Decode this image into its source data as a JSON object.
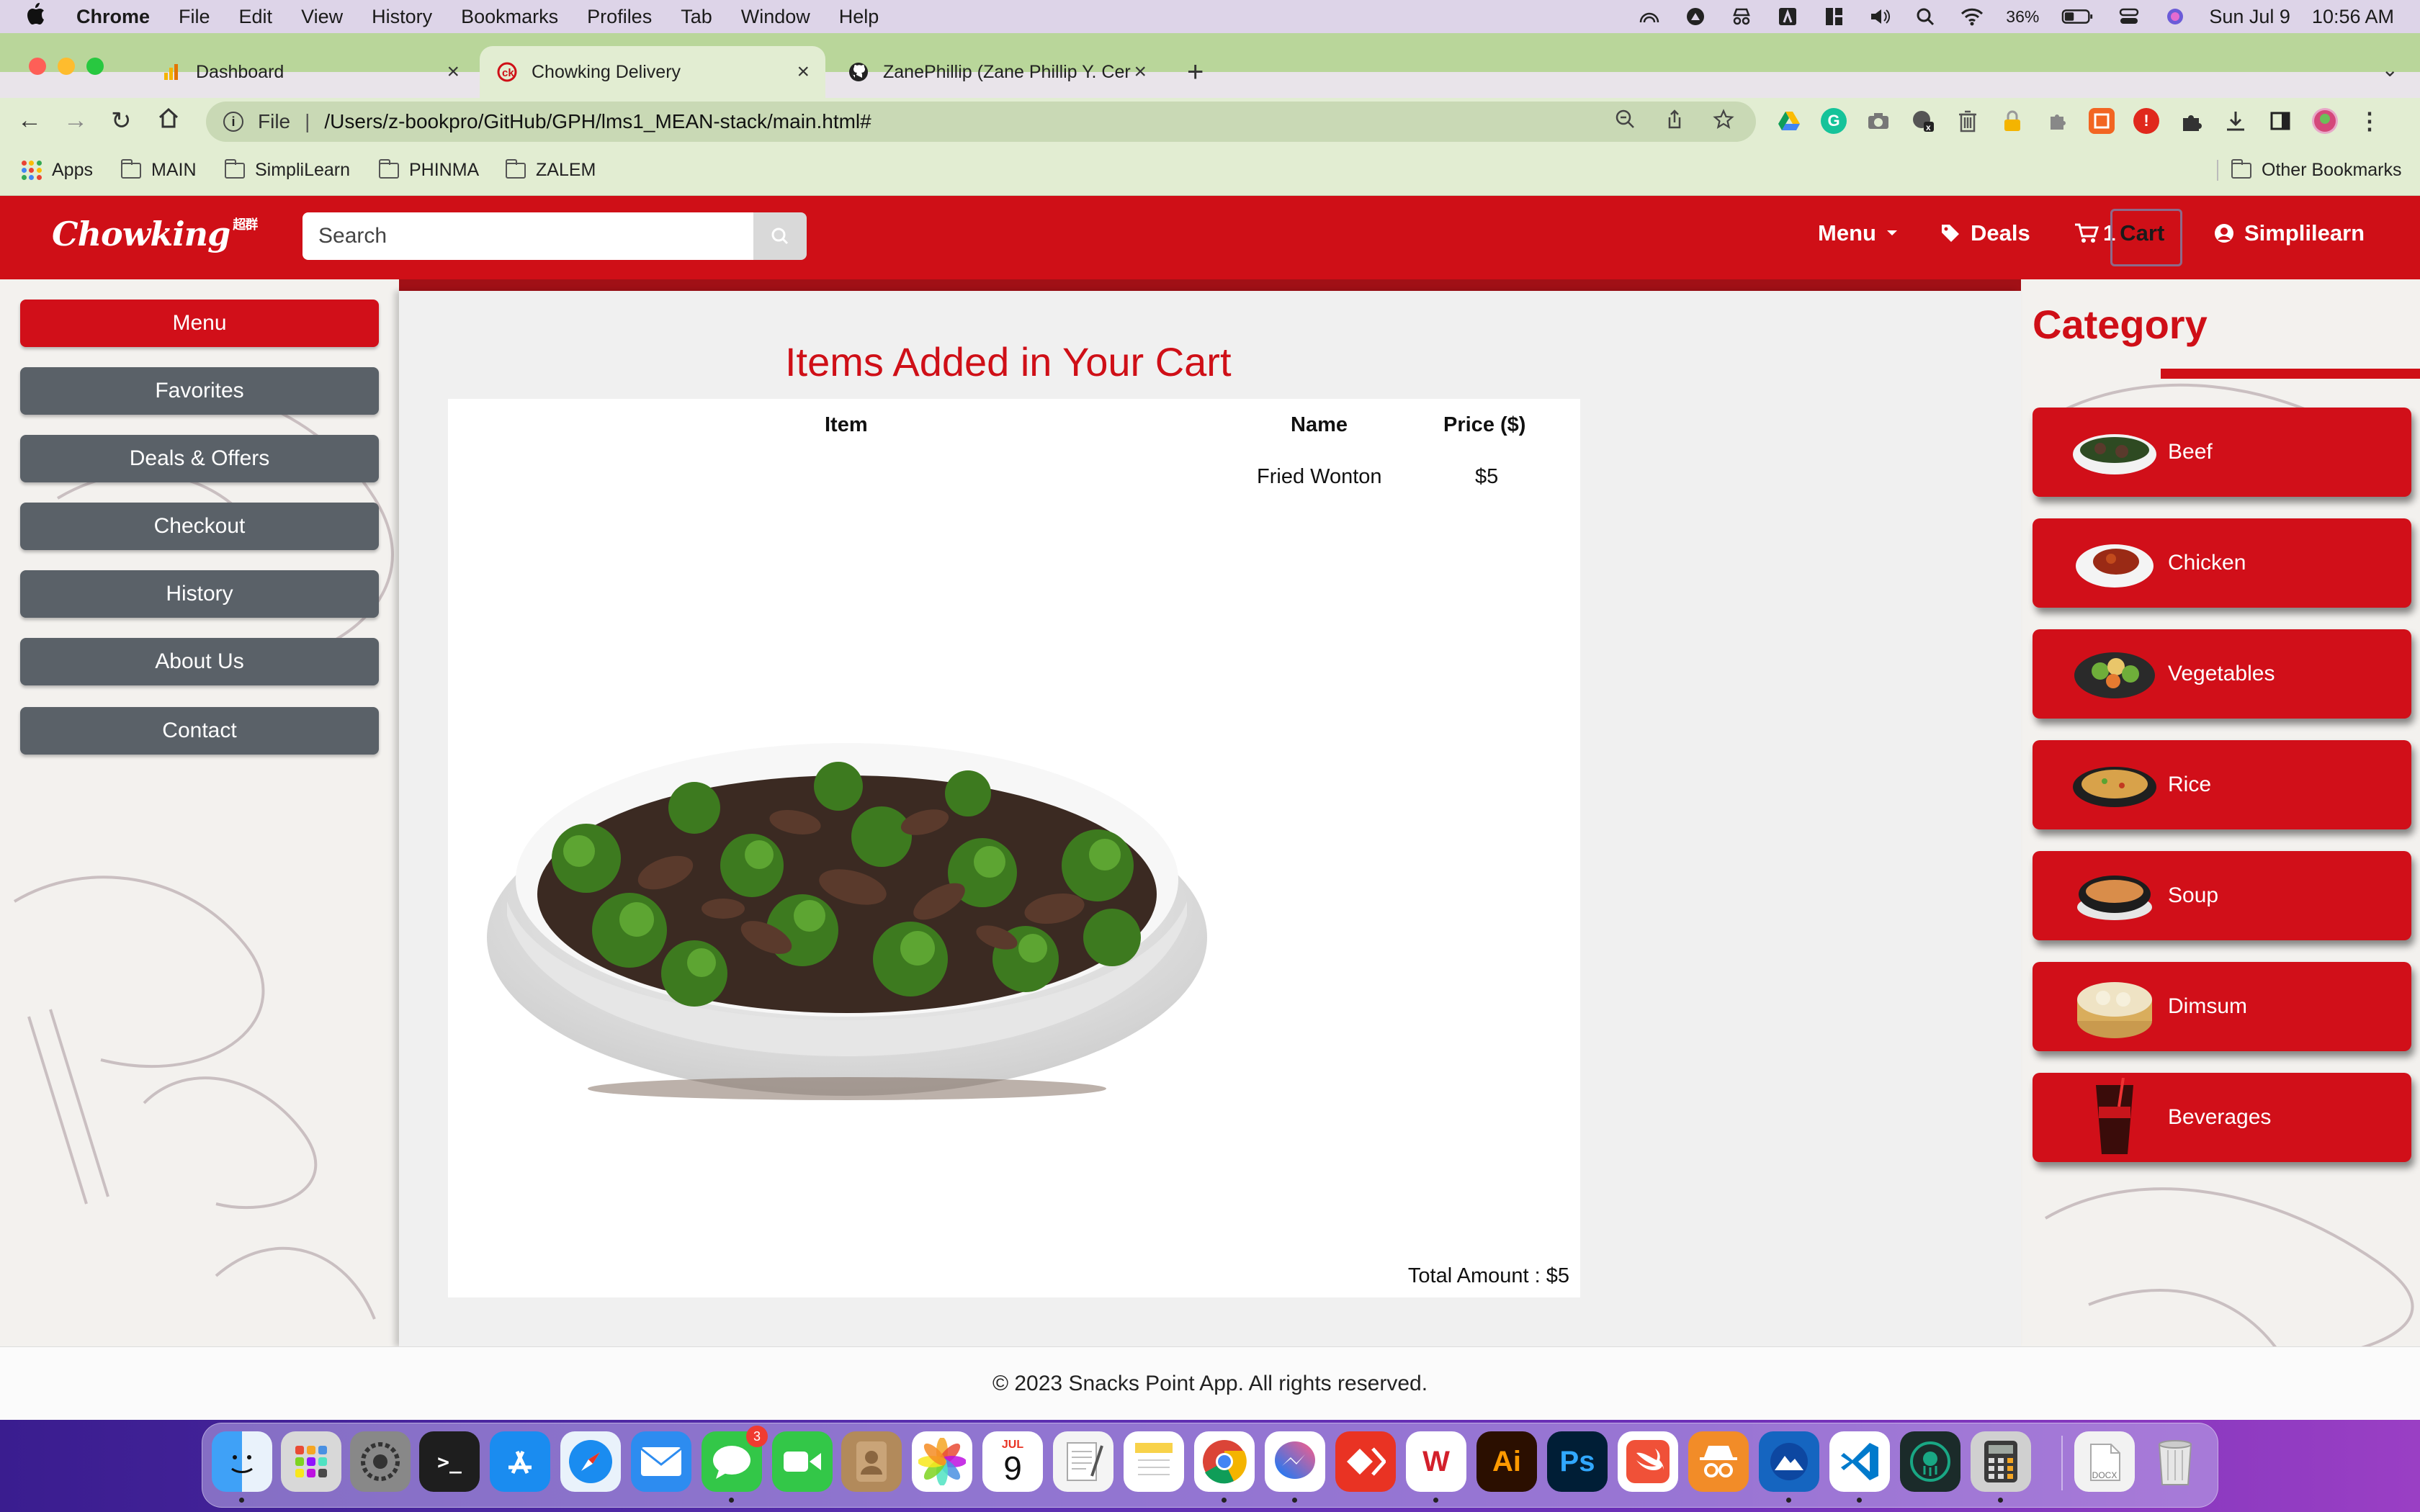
{
  "menubar": {
    "app": "Chrome",
    "items": [
      "File",
      "Edit",
      "View",
      "History",
      "Bookmarks",
      "Profiles",
      "Tab",
      "Window",
      "Help"
    ],
    "battery": "36%",
    "date": "Sun Jul 9",
    "time": "10:56 AM"
  },
  "tabs": [
    {
      "title": "Dashboard"
    },
    {
      "title": "Chowking Delivery"
    },
    {
      "title": "ZanePhillip (Zane Phillip Y. Cer"
    }
  ],
  "address": {
    "scheme": "File",
    "url": "/Users/z-bookpro/GitHub/GPH/lms1_MEAN-stack/main.html#"
  },
  "bookmarks": {
    "apps": "Apps",
    "folders": [
      "MAIN",
      "SimpliLearn",
      "PHINMA",
      "ZALEM"
    ],
    "other": "Other Bookmarks"
  },
  "site": {
    "logo": "Chowking",
    "logo_mark": "超群",
    "search_placeholder": "Search",
    "nav": {
      "menu": "Menu",
      "deals": "Deals",
      "cart_count": "1",
      "cart": "Cart",
      "user": "Simplilearn"
    },
    "sidebar": [
      "Menu",
      "Favorites",
      "Deals & Offers",
      "Checkout",
      "History",
      "About Us",
      "Contact"
    ],
    "cart": {
      "heading": "Items Added in Your Cart",
      "columns": [
        "Item",
        "Name",
        "Price ($)"
      ],
      "rows": [
        {
          "name": "Fried Wonton",
          "price": "$5"
        }
      ],
      "total": "Total Amount : $5"
    },
    "category": {
      "title": "Category",
      "items": [
        "Beef",
        "Chicken",
        "Vegetables",
        "Rice",
        "Soup",
        "Dimsum",
        "Beverages"
      ]
    },
    "footer": "© 2023 Snacks Point App. All rights reserved."
  },
  "dock": {
    "calendar_month": "JUL",
    "calendar_day": "9",
    "messages_badge": "3",
    "docx_label": "DOCX"
  },
  "colors": {
    "brand_red": "#cf0f17",
    "sidebar_gray": "#5a6168",
    "tab_bar": "#b9d69a"
  }
}
